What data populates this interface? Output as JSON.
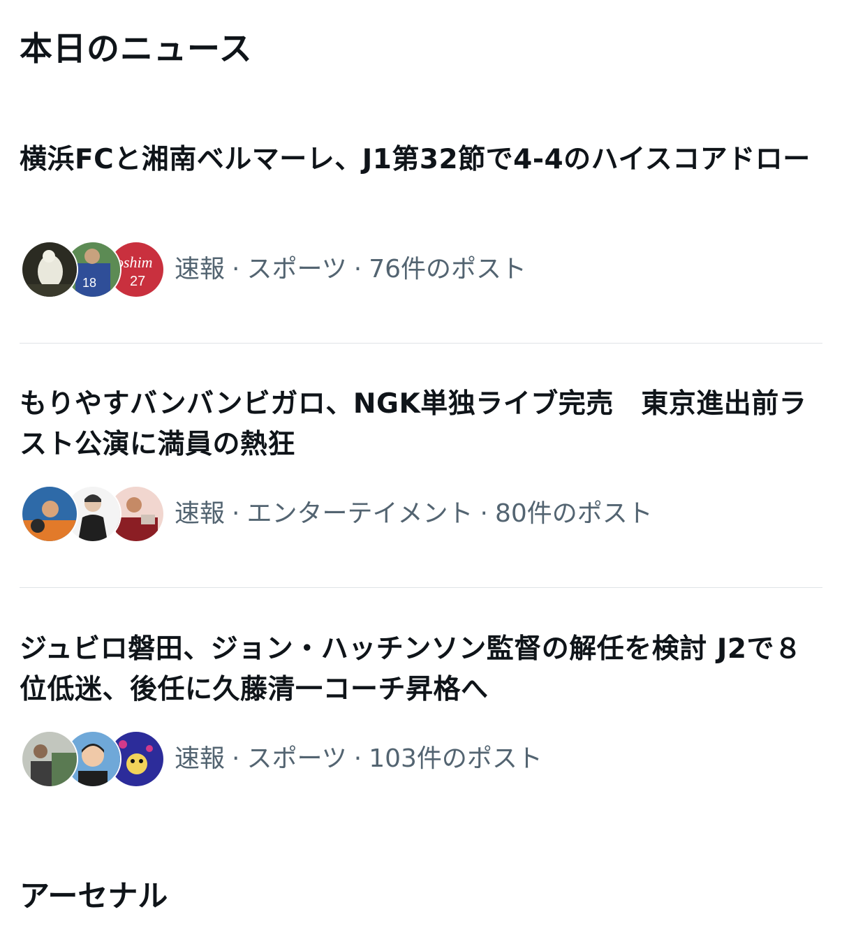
{
  "section": {
    "title": "本日のニュース"
  },
  "news": [
    {
      "headline": "横浜FCと湘南ベルマーレ、J1第32節で4-4のハイスコアドロー",
      "tag": "速報",
      "category": "スポーツ",
      "posts": "76件のポスト"
    },
    {
      "headline": "もりやすバンバンビガロ、NGK単独ライブ完売　東京進出前ラスト公演に満員の熱狂",
      "tag": "速報",
      "category": "エンターテイメント",
      "posts": "80件のポスト"
    },
    {
      "headline": "ジュビロ磐田、ジョン・ハッチンソン監督の解任を検討 J2で８位低迷、後任に久藤清一コーチ昇格へ",
      "tag": "速報",
      "category": "スポーツ",
      "posts": "103件のポスト"
    }
  ],
  "next_section": {
    "title": "アーセナル"
  },
  "colors": {
    "text_primary": "#0f1419",
    "text_secondary": "#536471",
    "divider": "#dfe3e6",
    "background": "#ffffff"
  }
}
